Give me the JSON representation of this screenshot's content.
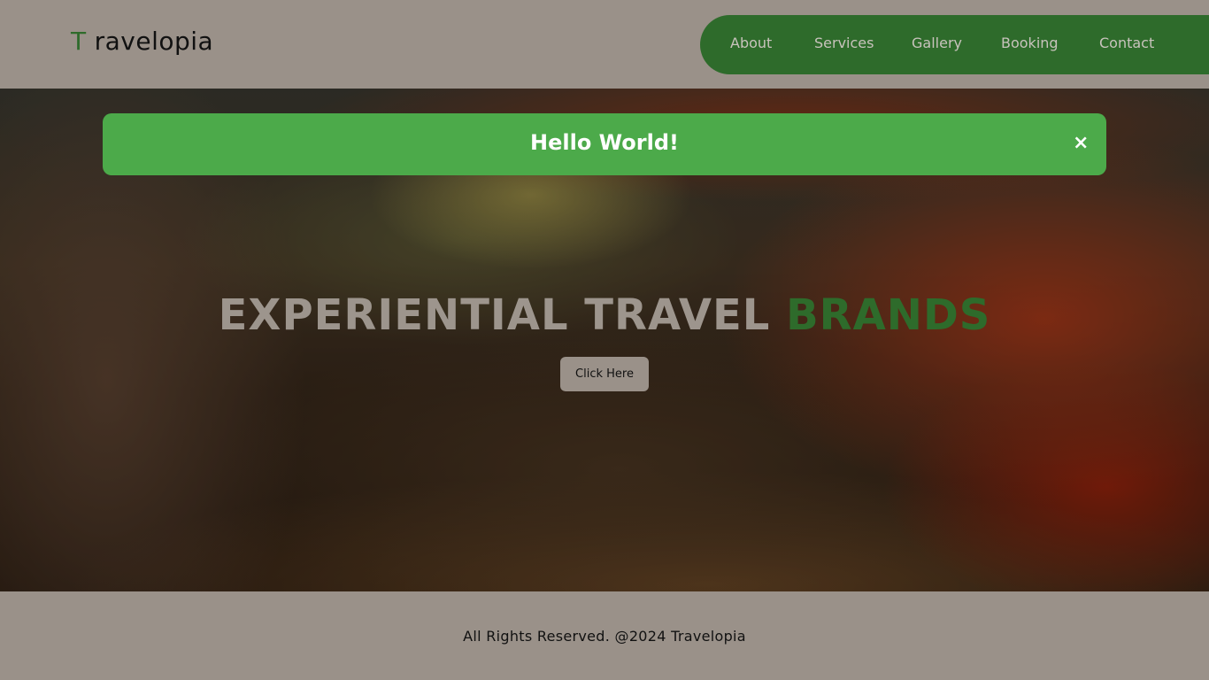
{
  "header": {
    "logo_initial": "T",
    "logo_rest": "ravelopia",
    "nav": [
      "About",
      "Services",
      "Gallery",
      "Booking",
      "Contact"
    ]
  },
  "alert": {
    "message": "Hello World!",
    "close_symbol": "×"
  },
  "hero": {
    "title_main": "EXPERIENTIAL TRAVEL",
    "title_accent": "BRANDS",
    "button_label": "Click Here"
  },
  "footer": {
    "text": "All Rights Reserved. @2024 Travelopia"
  },
  "colors": {
    "brand_green": "#2e6b2b",
    "alert_green": "#4caa4a",
    "surface_taupe": "#9a9189"
  },
  "icons": {
    "alert_close": "close-icon"
  }
}
